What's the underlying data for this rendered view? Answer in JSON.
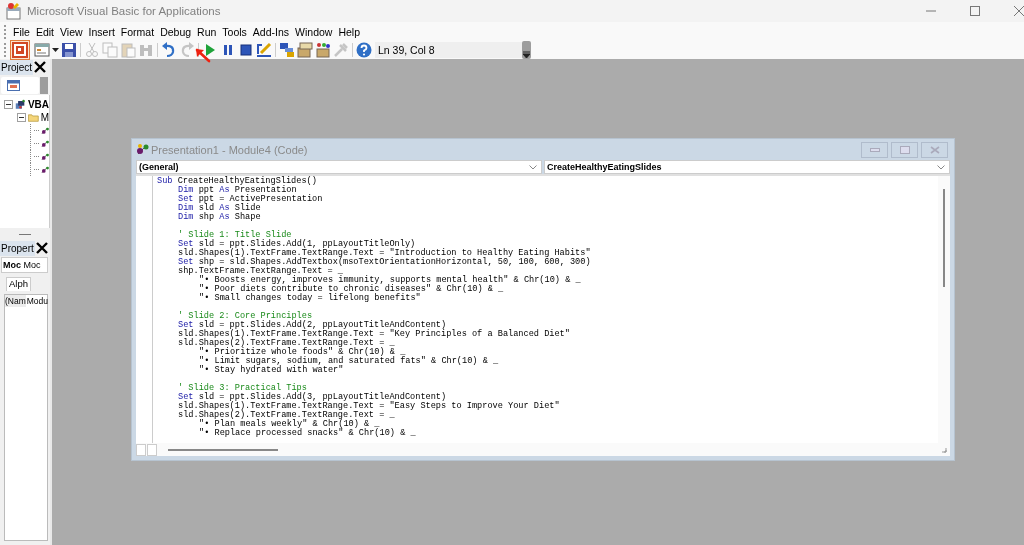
{
  "window": {
    "title": "Microsoft Visual Basic for Applications"
  },
  "menu": [
    {
      "label": "File"
    },
    {
      "label": "Edit"
    },
    {
      "label": "View"
    },
    {
      "label": "Insert"
    },
    {
      "label": "Format"
    },
    {
      "label": "Debug"
    },
    {
      "label": "Run"
    },
    {
      "label": "Tools"
    },
    {
      "label": "Add-Ins"
    },
    {
      "label": "Window"
    },
    {
      "label": "Help"
    }
  ],
  "toolbar": {
    "buttons": [
      {
        "kind": "button",
        "disabled": false
      },
      {
        "kind": "split",
        "disabled": false
      },
      {
        "kind": "button",
        "disabled": false
      },
      {
        "kind": "separator"
      },
      {
        "kind": "button",
        "disabled": true
      },
      {
        "kind": "button",
        "disabled": true
      },
      {
        "kind": "button",
        "disabled": true
      },
      {
        "kind": "button",
        "disabled": true
      },
      {
        "kind": "separator"
      },
      {
        "kind": "button",
        "disabled": false
      },
      {
        "kind": "button",
        "disabled": true
      },
      {
        "kind": "separator"
      },
      {
        "kind": "button",
        "disabled": false
      },
      {
        "kind": "button",
        "disabled": false
      },
      {
        "kind": "button",
        "disabled": false
      },
      {
        "kind": "button",
        "disabled": false
      },
      {
        "kind": "separator"
      },
      {
        "kind": "button",
        "disabled": false
      },
      {
        "kind": "button",
        "disabled": false
      },
      {
        "kind": "button",
        "disabled": false
      },
      {
        "kind": "button",
        "disabled": true
      },
      {
        "kind": "separator"
      },
      {
        "kind": "button",
        "disabled": false
      }
    ],
    "position": "Ln 39, Col 8"
  },
  "project_pane": {
    "title": "Project",
    "tree": [
      {
        "label": "VBA",
        "expanded": true,
        "children": [
          {
            "label": "M",
            "expanded": true,
            "children": [
              {
                "kind": "module"
              },
              {
                "kind": "module"
              },
              {
                "kind": "module"
              },
              {
                "kind": "module"
              }
            ]
          }
        ]
      }
    ]
  },
  "properties_pane": {
    "title": "Propert",
    "object": {
      "name": "Moc",
      "type": "Moc"
    },
    "tabs": [
      {
        "label": "Alph",
        "selected": true
      }
    ],
    "rows": [
      {
        "name": "(Nam",
        "value": "Modu"
      }
    ]
  },
  "code_window": {
    "title": "Presentation1 - Module4 (Code)",
    "object_combo": "(General)",
    "procedure_combo": "CreateHealthyEatingSlides",
    "lines": [
      {
        "segments": [
          {
            "kind": "keyword",
            "text": "Sub"
          },
          {
            "kind": "plain",
            "text": " CreateHealthyEatingSlides()"
          }
        ],
        "children": [
          {
            "segments": [
              {
                "kind": "keyword",
                "text": "Dim"
              },
              {
                "kind": "plain",
                "text": " ppt "
              },
              {
                "kind": "keyword",
                "text": "As"
              },
              {
                "kind": "plain",
                "text": " Presentation"
              }
            ]
          },
          {
            "segments": [
              {
                "kind": "keyword",
                "text": "Set"
              },
              {
                "kind": "plain",
                "text": " ppt = ActivePresentation"
              }
            ]
          },
          {
            "segments": [
              {
                "kind": "keyword",
                "text": "Dim"
              },
              {
                "kind": "plain",
                "text": " sld "
              },
              {
                "kind": "keyword",
                "text": "As"
              },
              {
                "kind": "plain",
                "text": " Slide"
              }
            ]
          },
          {
            "segments": [
              {
                "kind": "keyword",
                "text": "Dim"
              },
              {
                "kind": "plain",
                "text": " shp "
              },
              {
                "kind": "keyword",
                "text": "As"
              },
              {
                "kind": "plain",
                "text": " Shape"
              }
            ]
          },
          {
            "kind": "blank"
          },
          {
            "segments": [
              {
                "kind": "comment",
                "text": "' Slide 1: Title Slide"
              }
            ]
          },
          {
            "segments": [
              {
                "kind": "keyword",
                "text": "Set"
              },
              {
                "kind": "plain",
                "text": " sld = ppt.Slides.Add(1, ppLayoutTitleOnly)"
              }
            ]
          },
          {
            "segments": [
              {
                "kind": "plain",
                "text": "sld.Shapes(1).TextFrame.TextRange.Text = \"Introduction to Healthy Eating Habits\""
              }
            ]
          },
          {
            "segments": [
              {
                "kind": "keyword",
                "text": "Set"
              },
              {
                "kind": "plain",
                "text": " shp = sld.Shapes.AddTextbox(msoTextOrientationHorizontal, 50, 100, 600, 300)"
              }
            ]
          },
          {
            "segments": [
              {
                "kind": "plain",
                "text": "shp.TextFrame.TextRange.Text = _"
              }
            ],
            "children": [
              {
                "segments": [
                  {
                    "kind": "plain",
                    "text": "\"• Boosts energy, improves immunity, supports mental health\" & Chr(10) & _"
                  }
                ]
              },
              {
                "segments": [
                  {
                    "kind": "plain",
                    "text": "\"• Poor diets contribute to chronic diseases\" & Chr(10) & _"
                  }
                ]
              },
              {
                "segments": [
                  {
                    "kind": "plain",
                    "text": "\"• Small changes today = lifelong benefits\""
                  }
                ]
              }
            ]
          },
          {
            "kind": "blank"
          },
          {
            "segments": [
              {
                "kind": "comment",
                "text": "' Slide 2: Core Principles"
              }
            ]
          },
          {
            "segments": [
              {
                "kind": "keyword",
                "text": "Set"
              },
              {
                "kind": "plain",
                "text": " sld = ppt.Slides.Add(2, ppLayoutTitleAndContent)"
              }
            ]
          },
          {
            "segments": [
              {
                "kind": "plain",
                "text": "sld.Shapes(1).TextFrame.TextRange.Text = \"Key Principles of a Balanced Diet\""
              }
            ]
          },
          {
            "segments": [
              {
                "kind": "plain",
                "text": "sld.Shapes(2).TextFrame.TextRange.Text = _"
              }
            ],
            "children": [
              {
                "segments": [
                  {
                    "kind": "plain",
                    "text": "\"• Prioritize whole foods\" & Chr(10) & _"
                  }
                ]
              },
              {
                "segments": [
                  {
                    "kind": "plain",
                    "text": "\"• Limit sugars, sodium, and saturated fats\" & Chr(10) & _"
                  }
                ]
              },
              {
                "segments": [
                  {
                    "kind": "plain",
                    "text": "\"• Stay hydrated with water\""
                  }
                ]
              }
            ]
          },
          {
            "kind": "blank"
          },
          {
            "segments": [
              {
                "kind": "comment",
                "text": "' Slide 3: Practical Tips"
              }
            ]
          },
          {
            "segments": [
              {
                "kind": "keyword",
                "text": "Set"
              },
              {
                "kind": "plain",
                "text": " sld = ppt.Slides.Add(3, ppLayoutTitleAndContent)"
              }
            ]
          },
          {
            "segments": [
              {
                "kind": "plain",
                "text": "sld.Shapes(1).TextFrame.TextRange.Text = \"Easy Steps to Improve Your Diet\""
              }
            ]
          },
          {
            "segments": [
              {
                "kind": "plain",
                "text": "sld.Shapes(2).TextFrame.TextRange.Text = _"
              }
            ],
            "children": [
              {
                "segments": [
                  {
                    "kind": "plain",
                    "text": "\"• Plan meals weekly\" & Chr(10) & _"
                  }
                ]
              },
              {
                "segments": [
                  {
                    "kind": "plain",
                    "text": "\"• Replace processed snacks\" & Chr(10) & _"
                  }
                ]
              }
            ]
          }
        ]
      }
    ]
  }
}
